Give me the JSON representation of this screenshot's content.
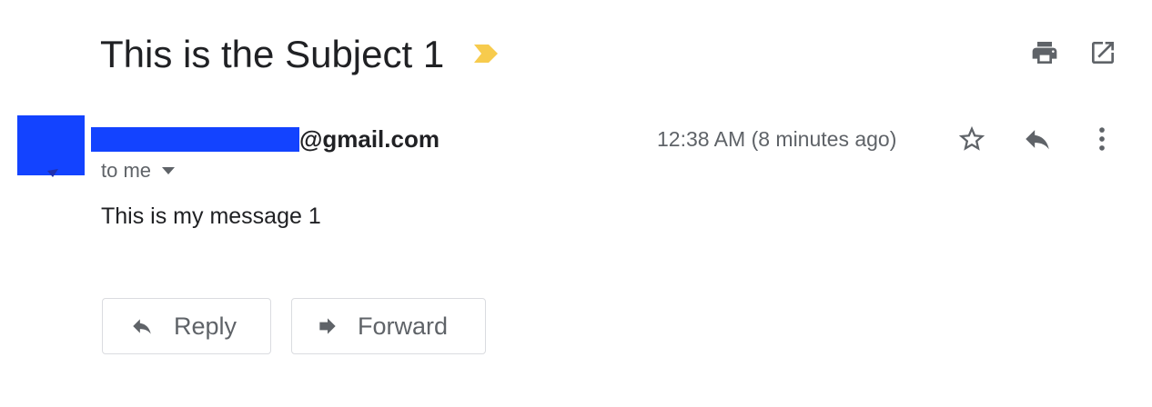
{
  "email": {
    "subject": "This is the Subject 1",
    "sender_domain": "@gmail.com",
    "recipient": "to me",
    "timestamp": "12:38 AM (8 minutes ago)",
    "body": "This is my message 1"
  },
  "actions": {
    "reply_label": "Reply",
    "forward_label": "Forward"
  },
  "icons": {
    "importance": "importance-marker-icon",
    "print": "print-icon",
    "new_window": "open-in-new-window-icon",
    "star": "star-icon",
    "reply": "reply-icon",
    "more": "more-vert-icon",
    "caret": "caret-down-icon",
    "forward": "forward-icon"
  },
  "colors": {
    "importance": "#f7cb4d",
    "redaction": "#1343ff",
    "icon_gray": "#5f6368",
    "text_dark": "#202124",
    "button_border": "#dadce0"
  }
}
